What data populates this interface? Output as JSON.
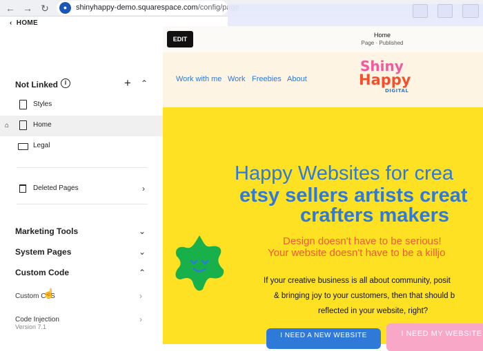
{
  "browser": {
    "url_host": "shinyhappy-demo.squarespace.com",
    "url_path": "/config/page"
  },
  "left_panel": {
    "home_label": "HOME",
    "not_linked": {
      "title": "Not Linked",
      "items": [
        {
          "label": "Styles",
          "icon": "page-icon"
        },
        {
          "label": "Home",
          "icon": "page-icon",
          "active": true,
          "homepage": true
        },
        {
          "label": "Legal",
          "icon": "link-icon"
        }
      ]
    },
    "deleted_pages": "Deleted Pages",
    "sections": [
      {
        "title": "Marketing Tools",
        "expanded": false
      },
      {
        "title": "System Pages",
        "expanded": false
      },
      {
        "title": "Custom Code",
        "expanded": true
      }
    ],
    "custom_code_items": [
      "Custom CSS",
      "Code Injection"
    ],
    "version": "Version 7.1"
  },
  "editor": {
    "edit_label": "EDIT",
    "page_title": "Home",
    "page_status": "Page · Published"
  },
  "site": {
    "nav": [
      "Work with me",
      "Work",
      "Freebies",
      "About"
    ],
    "logo": {
      "line1": "Shiny",
      "line2": "Happy",
      "line3": "DIGITAL"
    },
    "hero": {
      "heading_light": "Happy Websites for crea",
      "heading_bold_1": "etsy sellers artists creat",
      "heading_bold_2": "crafters makers",
      "sub_1": "Design doesn't have to be serious!",
      "sub_2": "Your website doesn't have to be a killjo",
      "body_1": "If your creative business is all about community, posit",
      "body_2": "& bringing joy to your customers, then that should b",
      "body_3": "reflected in your website, right?",
      "cta_1": "I NEED A NEW WEBSITE",
      "cta_2": "I NEED MY WEBSITE"
    }
  },
  "colors": {
    "accent_blue": "#2f79d8",
    "hero_yellow": "#fde122",
    "hero_orange": "#f25a33",
    "star_green": "#17b04a",
    "cta_pink": "#f8a7c6"
  }
}
